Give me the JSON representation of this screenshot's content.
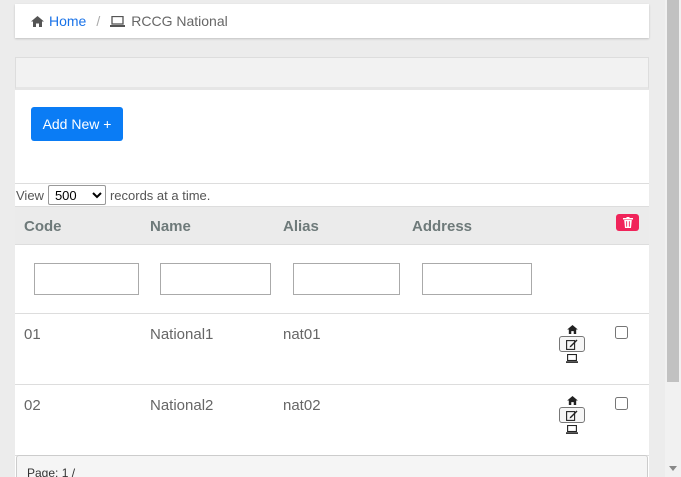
{
  "breadcrumb": {
    "home_icon": "home-icon",
    "home_label": "Home",
    "separator": "/",
    "current_icon": "laptop-icon",
    "current_label": "RCCG National"
  },
  "toolbar": {
    "add_label": "Add New +"
  },
  "view_control": {
    "prefix": "View",
    "selected": "500",
    "suffix": "records at a time."
  },
  "table": {
    "headers": [
      "Code",
      "Name",
      "Alias",
      "Address"
    ],
    "delete_icon": "trash-icon",
    "rows": [
      {
        "code": "01",
        "name": "National1",
        "alias": "nat01",
        "address": ""
      },
      {
        "code": "02",
        "name": "National2",
        "alias": "nat02",
        "address": ""
      }
    ],
    "row_action_icons": [
      "home-icon",
      "edit-icon",
      "laptop-icon"
    ]
  },
  "pager": {
    "text": "Page: 1 /"
  },
  "colors": {
    "primary": "#0a7cf5",
    "danger": "#f0245a",
    "link": "#1a73e8"
  }
}
